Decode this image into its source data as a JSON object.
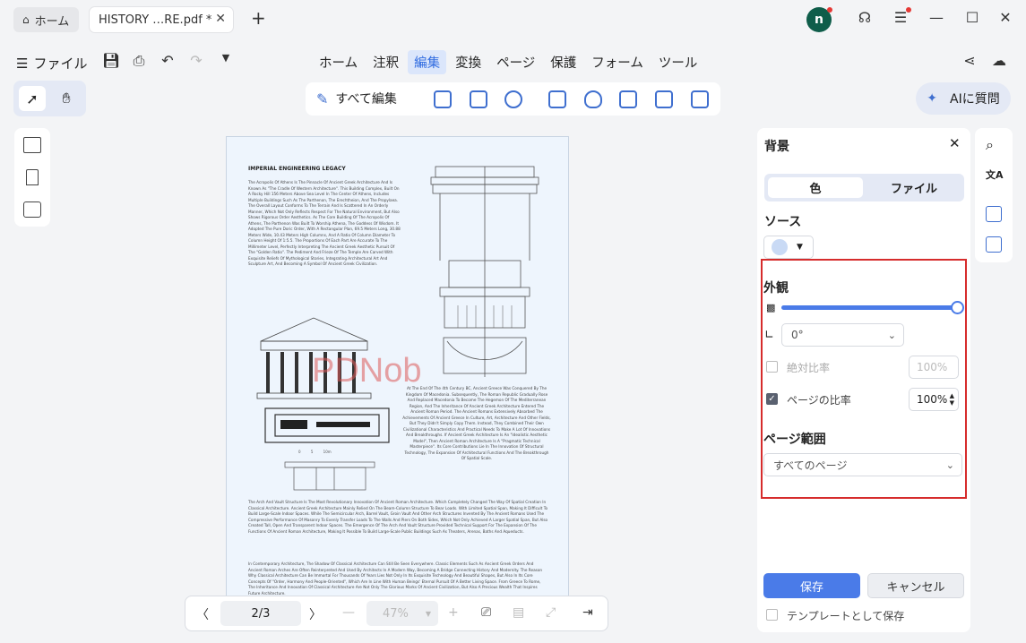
{
  "tabs": {
    "home_label": "ホーム",
    "doc_label": "HISTORY …RE.pdf *",
    "avatar_initial": "n"
  },
  "menubar": {
    "file_label": "ファイル",
    "items": [
      "ホーム",
      "注釈",
      "編集",
      "変換",
      "ページ",
      "保護",
      "フォーム",
      "ツール"
    ],
    "active": "編集"
  },
  "edit_toolbar": {
    "edit_all_label": "すべて編集"
  },
  "ai_button": {
    "label": "AIに質問"
  },
  "document": {
    "title": "IMPERIAL ENGINEERING LEGACY",
    "paragraph1": "The Acropolis Of Athens Is The Pinnacle Of Ancient Greek Architecture And Is Known As \"The Cradle Of Western Architecture\". This Building Complex, Built On A Rocky Hill 156 Meters Above Sea Level In The Center Of Athens, Includes Multiple Buildings Such As The Parthenon, The Erechtheion, And The Propylaea. The Overall Layout Conforms To The Terrain And Is Scattered In An Orderly Manner, Which Not Only Reflects Respect For The Natural Environment, But Also Shows Rigorous Order Aesthetics. As The Core Building Of The Acropolis Of Athens, The Parthenon Was Built To Worship Athena, The Goddess Of Wisdom. It Adopted The Pure Doric Order, With A Rectangular Plan, 69.5 Meters Long, 30.88 Meters Wide, 10.43 Meters High Columns, And A Ratio Of Column Diameter To Column Height Of 1:5.5. The Proportions Of Each Part Are Accurate To The Millimeter Level, Perfectly Interpreting The Ancient Greek Aesthetic Pursuit Of The \"Golden Ratio\". The Pediment And Frieze Of The Temple Are Carved With Exquisite Reliefs Of Mythological Stories, Integrating Architectural Art And Sculpture Art, And Becoming A Symbol Of Ancient Greek Civilization.",
    "paragraph2": "At The End Of The 4th Century BC, Ancient Greece Was Conquered By The Kingdom Of Macedonia. Subsequently, The Roman Republic Gradually Rose And Replaced Macedonia To Become The Hegemon Of The Mediterranean Region, And The Inheritance Of Ancient Greek Architecture Entered The Ancient Roman Period. The Ancient Romans Extensively Absorbed The Achievements Of Ancient Greece In Culture, Art, Architecture And Other Fields, But They Didn't Simply Copy Them. Instead, They Combined Their Own Civilizational Characteristics And Practical Needs To Make A Lot Of Innovations And Breakthroughs. If Ancient Greek Architecture Is An \"Idealistic Aesthetic Model\", Then Ancient Roman Architecture Is A \"Pragmatic Technical Masterpiece\". Its Core Contributions Lie In The Innovation Of Structural Technology, The Expansion Of Architectural Functions And The Breakthrough Of Spatial Scale.",
    "paragraph3": "The Arch And Vault Structure Is The Most Revolutionary Innovation Of Ancient Roman Architecture. Which Completely Changed The Way Of Spatial Creation In Classical Architecture. Ancient Greek Architecture Mainly Relied On The Beam-Column Structure To Bear Loads. With Limited Spatial Span, Making It Difficult To Build Large-Scale Indoor Spaces. While The Semicircular Arch, Barrel Vault, Groin Vault And Other Arch Structures Invented By The Ancient Romans Used The Compressive Performance Of Masonry To Evenly Transfer Loads To The Walls And Piers On Both Sides, Which Not Only Achieved A Larger Spatial Span, But Also Created Tall, Open And Transparent Indoor Spaces. The Emergence Of The Arch And Vault Structure Provided Technical Support For The Expansion Of The Functions Of Ancient Roman Architecture, Making It Possible To Build Large-Scale Public Buildings Such As Theaters, Arenas, Baths And Aqueducts.",
    "paragraph4": "In Contemporary Architecture, The Shadow Of Classical Architecture Can Still Be Seen Everywhere. Classic Elements Such As Ancient Greek Orders And Ancient Roman Arches Are Often Reinterpreted And Used By Architects In A Modern Way, Becoming A Bridge Connecting History And Modernity. The Reason Why Classical Architecture Can Be Immortal For Thousands Of Years Lies Not Only In Its Exquisite Technology And Beautiful Shapes, But Also In Its Core Concepts Of \"Order, Harmony And People-Oriented\", Which Are In Line With Human Beings' Eternal Pursuit Of A Better Living Space. From Greece To Rome, The Inheritance And Innovation Of Classical Architecture Are Not Only The Glorious Marks Of Ancient Civilization, But Also A Precious Wealth That Inspires Future Architecture.",
    "scale_labels": [
      "0",
      "5",
      "10m"
    ],
    "watermark": "PDNob"
  },
  "panel": {
    "title": "背景",
    "tab_color": "色",
    "tab_file": "ファイル",
    "source_label": "ソース",
    "appearance_label": "外観",
    "opacity": 1.0,
    "rotation_value": "0°",
    "absolute_ratio_label": "絶対比率",
    "absolute_ratio_value": "100%",
    "page_ratio_label": "ページの比率",
    "page_ratio_value": "100%",
    "page_range_label": "ページ範囲",
    "page_range_value": "すべてのページ",
    "save_label": "保存",
    "cancel_label": "キャンセル",
    "template_label": "テンプレートとして保存",
    "swatch_color": "#c9daf5",
    "accent_color": "#4a7be8"
  },
  "bottom_bar": {
    "page_indicator": "2/3",
    "zoom": "47%"
  }
}
